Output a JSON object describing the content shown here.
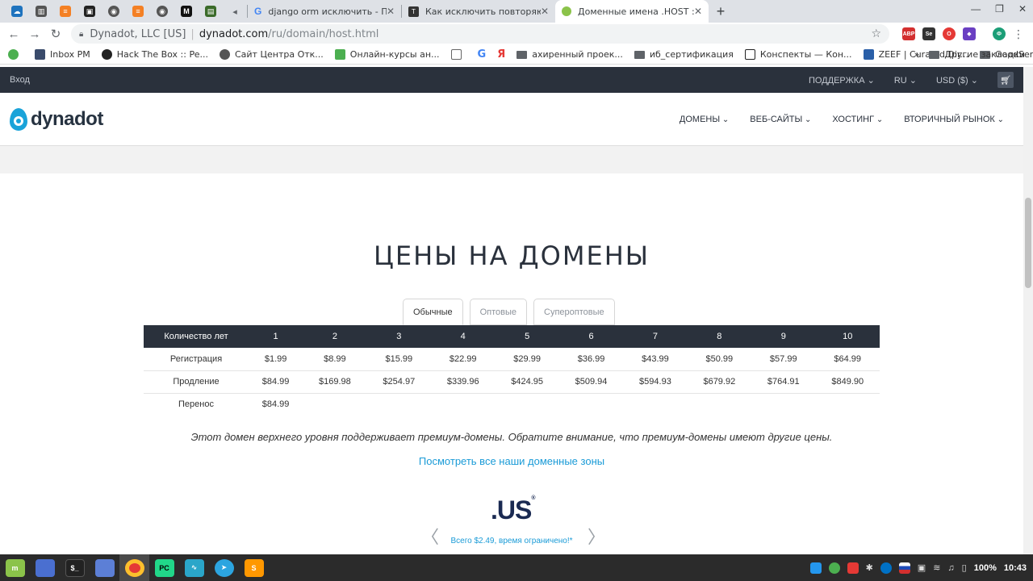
{
  "browser": {
    "tabs": [
      {
        "title": "django orm исключить - Поиск",
        "active": false
      },
      {
        "title": "Как исключить повторяющие",
        "active": false
      },
      {
        "title": "Доменные имена .HOST : Регистрация",
        "active": true
      }
    ],
    "address": {
      "org": "Dynadot, LLC [US]",
      "host": "dynadot.com",
      "path": "/ru/domain/host.html"
    },
    "bookmarks": [
      {
        "label": "Inbox PM",
        "kind": "site"
      },
      {
        "label": "Hack The Box :: Pe...",
        "kind": "site"
      },
      {
        "label": "Сайт Центра Отк...",
        "kind": "site"
      },
      {
        "label": "Онлайн-курсы ан...",
        "kind": "site"
      },
      {
        "label": "ахиренный проек...",
        "kind": "folder"
      },
      {
        "label": "иб_сертификация",
        "kind": "folder"
      },
      {
        "label": "Конспекты — Кон...",
        "kind": "site"
      },
      {
        "label": "ZEEF | Curated Dir...",
        "kind": "site"
      },
      {
        "label": "GoodService",
        "kind": "folder"
      }
    ],
    "bookmarks_more": "»",
    "other_bookmarks": "Другие закладки"
  },
  "site": {
    "topbar": {
      "login": "Вход",
      "support": "ПОДДЕРЖКА",
      "lang": "RU",
      "currency": "USD ($)"
    },
    "logo_text": "dynadot",
    "nav": [
      "ДОМЕНЫ",
      "ВЕБ-САЙТЫ",
      "ХОСТИНГ",
      "ВТОРИЧНЫЙ РЫНОК"
    ]
  },
  "pricing": {
    "title": "ЦЕНЫ НА ДОМЕНЫ",
    "tabs": [
      "Обычные",
      "Оптовые",
      "Супероптовые"
    ],
    "active_tab": 0,
    "header_label": "Количество лет",
    "years": [
      "1",
      "2",
      "3",
      "4",
      "5",
      "6",
      "7",
      "8",
      "9",
      "10"
    ],
    "rows": [
      {
        "label": "Регистрация",
        "values": [
          "$1.99",
          "$8.99",
          "$15.99",
          "$22.99",
          "$29.99",
          "$36.99",
          "$43.99",
          "$50.99",
          "$57.99",
          "$64.99"
        ]
      },
      {
        "label": "Продление",
        "values": [
          "$84.99",
          "$169.98",
          "$254.97",
          "$339.96",
          "$424.95",
          "$509.94",
          "$594.93",
          "$679.92",
          "$764.91",
          "$849.90"
        ]
      },
      {
        "label": "Перенос",
        "values": [
          "$84.99",
          "",
          "",
          "",
          "",
          "",
          "",
          "",
          "",
          ""
        ]
      }
    ],
    "note": "Этот домен верхнего уровня поддерживает премиум-домены. Обратите внимание, что премиум-домены имеют другие цены.",
    "all_zones_link": "Посмотреть все наши доменные зоны"
  },
  "promo": {
    "logo": ".US",
    "text": "Всего $2.49, время ограничено!*"
  },
  "taskbar": {
    "battery": "100%",
    "clock": "10:43"
  }
}
